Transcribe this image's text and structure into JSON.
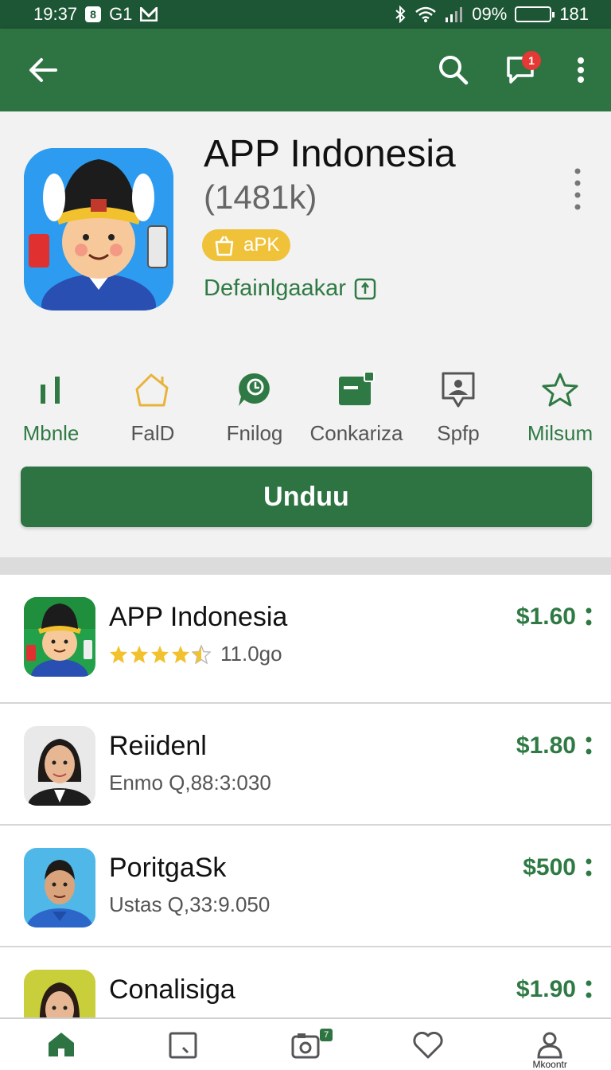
{
  "status_bar": {
    "time": "19:37",
    "carrier": "G1",
    "battery_percent": "09%",
    "right_number": "181"
  },
  "app_bar": {
    "notification_count": "1",
    "accent": "#2e7443"
  },
  "app": {
    "title": "APP Indonesia",
    "count": "(1481k)",
    "badge": "aPK",
    "developer": "Defainlgaakar"
  },
  "actions": [
    {
      "label": "Mbnle",
      "icon": "bars-icon"
    },
    {
      "label": "FalD",
      "icon": "house-icon"
    },
    {
      "label": "Fnilog",
      "icon": "chat-icon"
    },
    {
      "label": "Conkariza",
      "icon": "board-icon"
    },
    {
      "label": "Spfp",
      "icon": "image-bubble-icon"
    },
    {
      "label": "Milsum",
      "icon": "star-icon"
    }
  ],
  "download_label": "Unduu",
  "list": [
    {
      "title": "APP Indonesia",
      "subtitle": "11.0go",
      "price": "$1.60",
      "rating": 4.5
    },
    {
      "title": "Reiidenl",
      "subtitle": "Enmo Q,88:3:030",
      "price": "$1.80"
    },
    {
      "title": "PoritgaSk",
      "subtitle": "Ustas Q,33:9.050",
      "price": "$500"
    },
    {
      "title": "Conalisiga",
      "subtitle": "",
      "price": "$1.90"
    }
  ],
  "bottom_nav": {
    "badge": "7",
    "profile_label": "Mkoontr"
  }
}
